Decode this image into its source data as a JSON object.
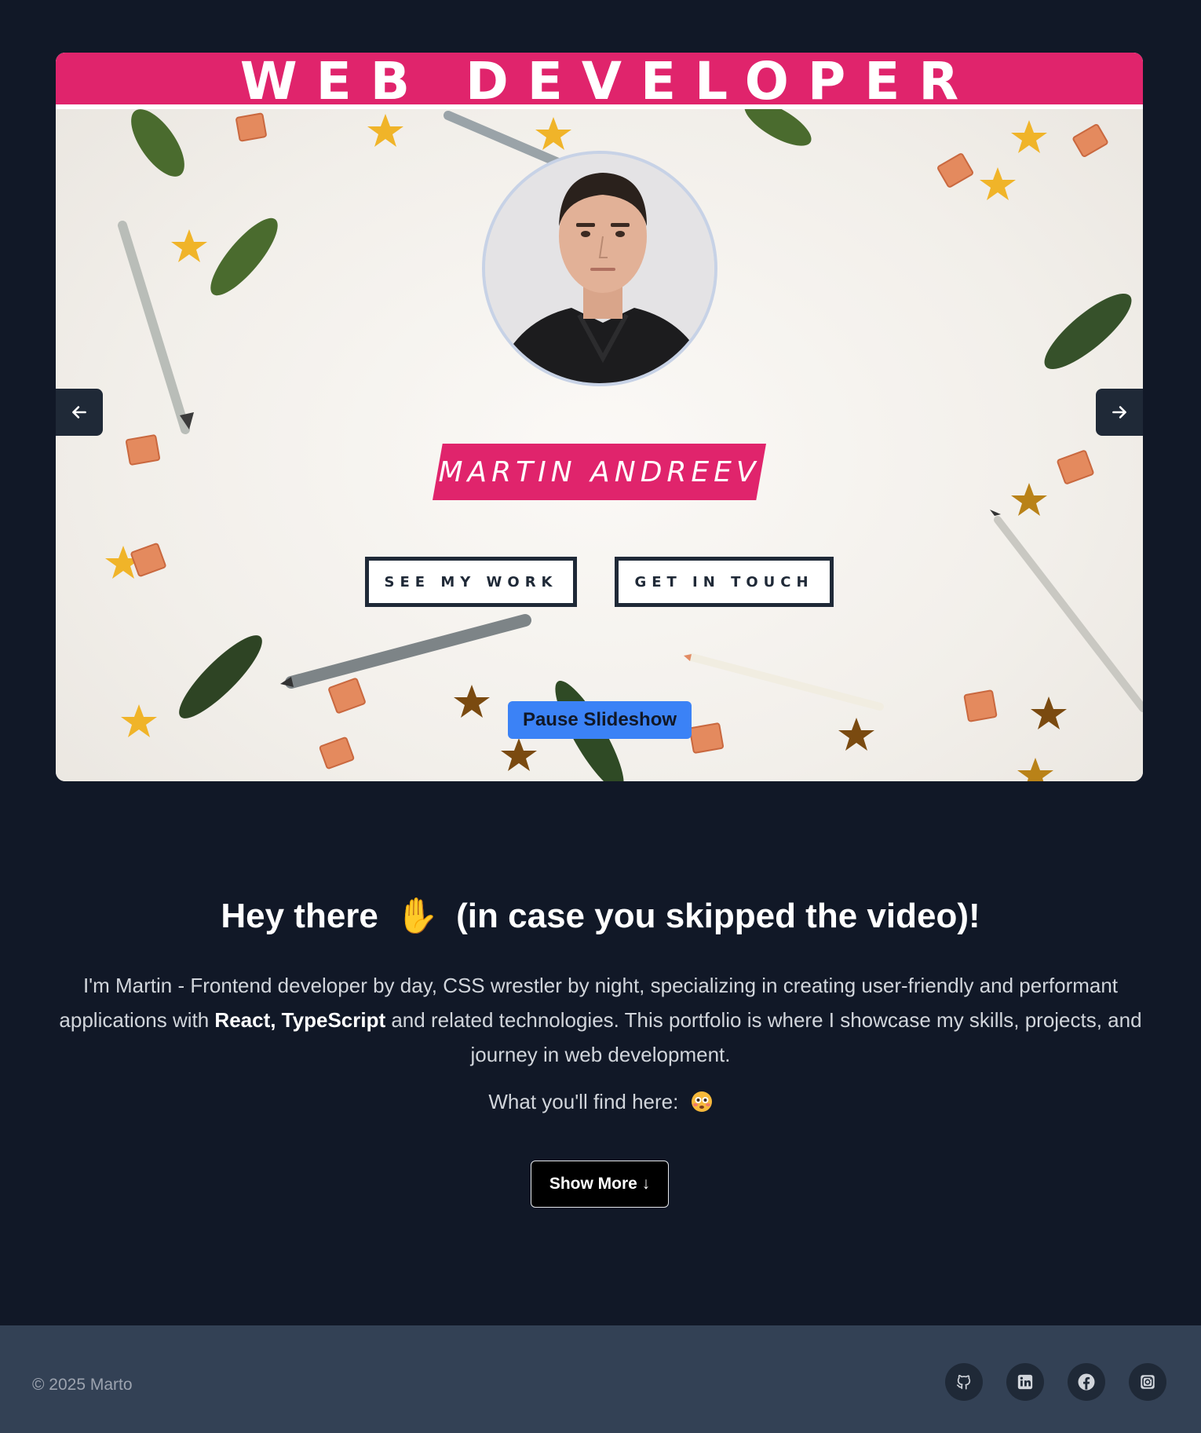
{
  "hero": {
    "banner_title": "WEB DEVELOPER",
    "name": "MARTIN ANDREEV",
    "see_work_label": "SEE MY WORK",
    "get_in_touch_label": "GET IN TOUCH",
    "pause_label": "Pause Slideshow",
    "prev_icon": "arrow-left-icon",
    "next_icon": "arrow-right-icon"
  },
  "intro": {
    "title_start": "Hey there",
    "title_emoji": "✋",
    "title_end": "(in case you skipped the video)!",
    "text_part1": "I'm Martin - Frontend developer by day, CSS wrestler by night, specializing in creating user-friendly and performant applications with ",
    "text_bold": "React, TypeScript",
    "text_part2": " and related technologies. This portfolio is where I showcase my skills, projects, and journey in web development.",
    "find_here": "What you'll find here:",
    "show_more_label": "Show More ↓"
  },
  "footer": {
    "copyright": "© 2025 Marto",
    "socials": [
      "github-icon",
      "linkedin-icon",
      "facebook-icon",
      "instagram-icon"
    ]
  },
  "colors": {
    "page_bg": "#111827",
    "accent_pink": "#e0246c",
    "pause_blue": "#3b82f6",
    "footer_bg": "#334155"
  }
}
